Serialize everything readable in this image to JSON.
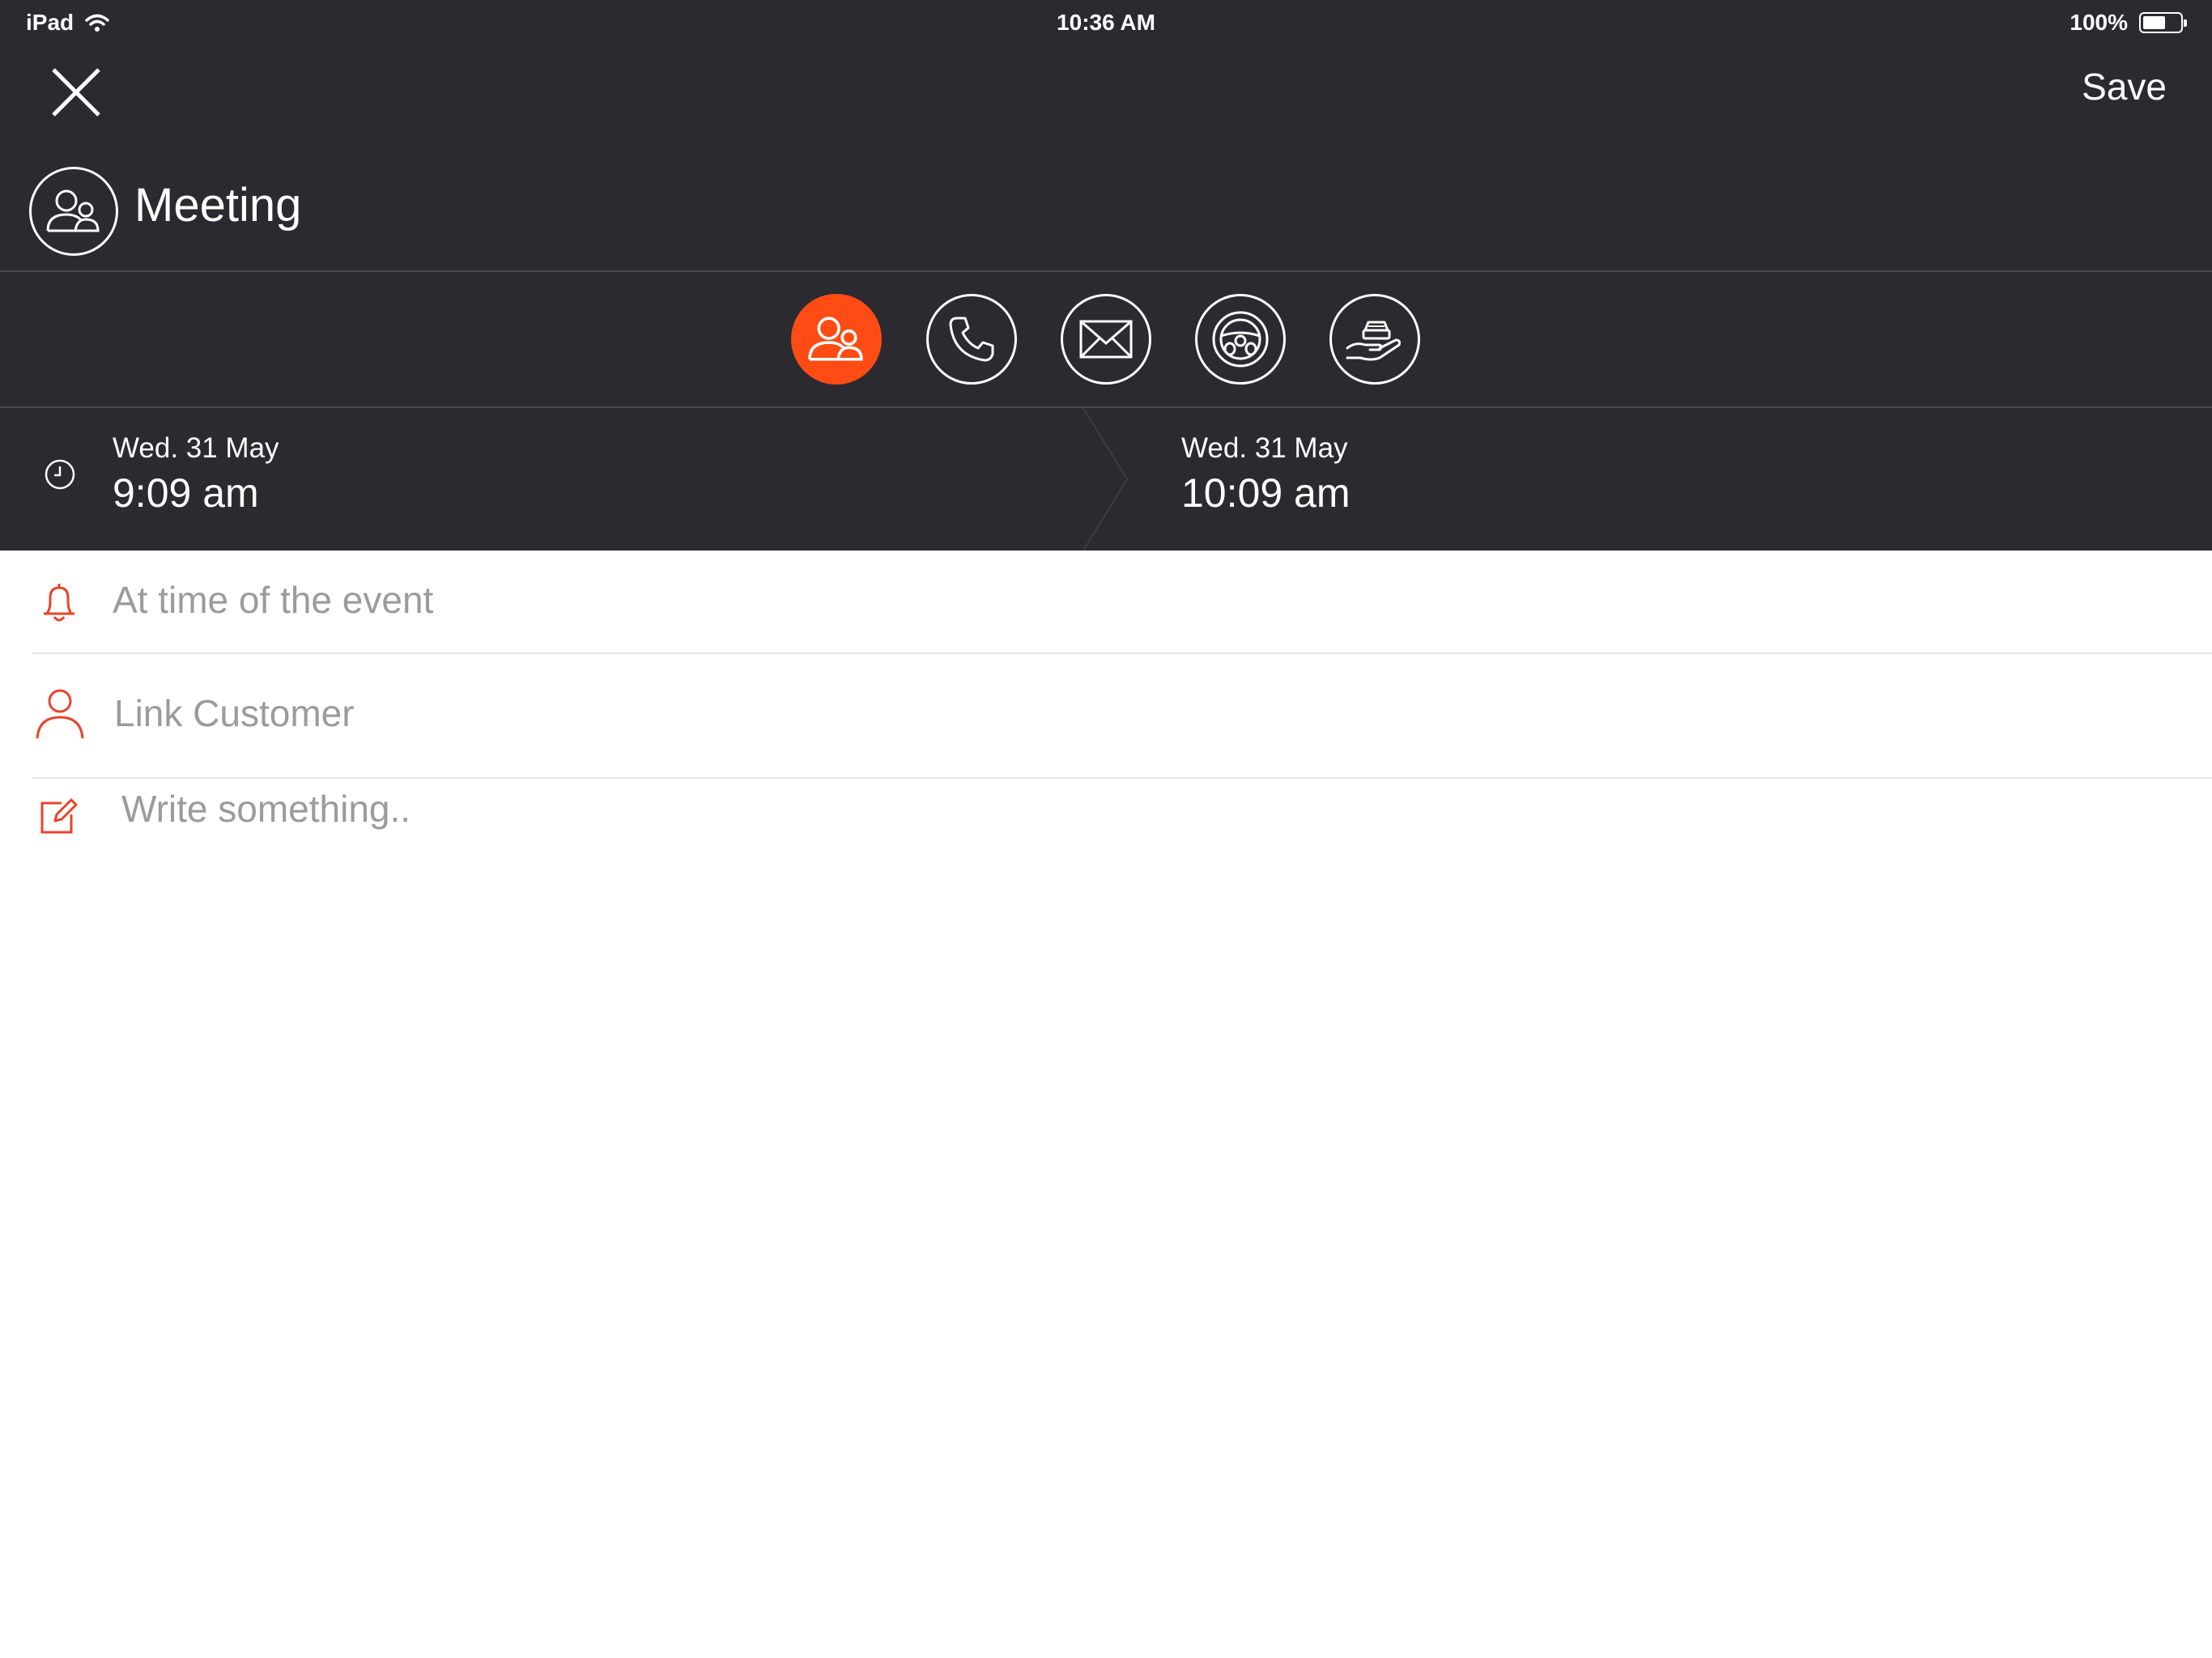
{
  "status_bar": {
    "device": "iPad",
    "time": "10:36 AM",
    "battery_text": "100%",
    "battery_level": 0.62
  },
  "nav": {
    "save_label": "Save"
  },
  "title": {
    "text": "Meeting",
    "icon": "meeting-icon"
  },
  "event_types": [
    {
      "icon": "meeting-icon",
      "active": true
    },
    {
      "icon": "phone-icon",
      "active": false
    },
    {
      "icon": "envelope-icon",
      "active": false
    },
    {
      "icon": "steering-wheel-icon",
      "active": false
    },
    {
      "icon": "car-delivery-icon",
      "active": false
    }
  ],
  "dates": {
    "start": {
      "date": "Wed. 31 May",
      "time": "9:09 am"
    },
    "end": {
      "date": "Wed. 31 May",
      "time": "10:09 am"
    }
  },
  "form": {
    "reminder": "At time of the event",
    "link_customer": "Link Customer",
    "note_placeholder": "Write something.."
  },
  "colors": {
    "dark_bg": "#2a2a30",
    "accent": "#ff4b14",
    "placeholder": "#9b9b9b"
  }
}
